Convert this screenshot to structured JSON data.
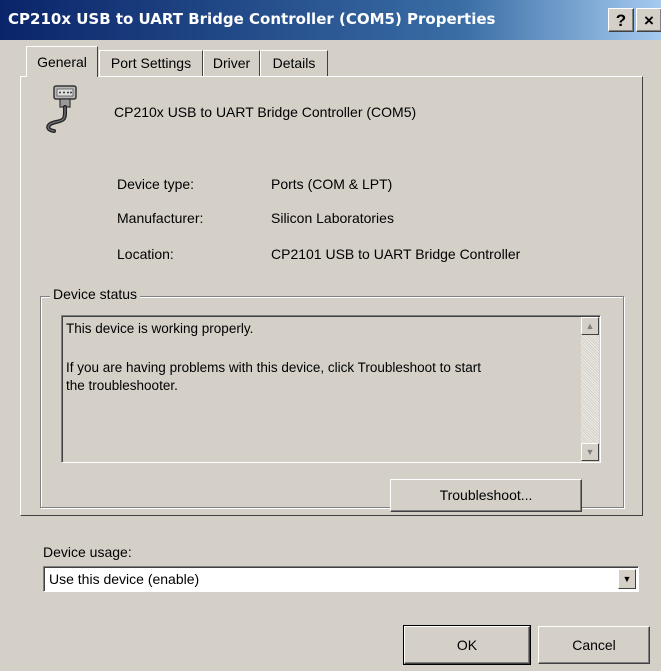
{
  "window": {
    "title": "CP210x USB to UART Bridge Controller (COM5) Properties",
    "help_label": "?",
    "close_label": "×"
  },
  "tabs": [
    {
      "label": "General",
      "active": true
    },
    {
      "label": "Port Settings",
      "active": false
    },
    {
      "label": "Driver",
      "active": false
    },
    {
      "label": "Details",
      "active": false
    }
  ],
  "device": {
    "icon": "serial-port-icon",
    "name": "CP210x USB to UART Bridge Controller (COM5)"
  },
  "properties": [
    {
      "label": "Device type:",
      "value": "Ports (COM & LPT)"
    },
    {
      "label": "Manufacturer:",
      "value": "Silicon Laboratories"
    },
    {
      "label": "Location:",
      "value": "CP2101 USB to UART Bridge Controller"
    }
  ],
  "device_status": {
    "legend": "Device status",
    "lines": [
      "This device is working properly.",
      "",
      "If you are having problems with this device, click Troubleshoot to start",
      "the troubleshooter."
    ],
    "troubleshoot_label": "Troubleshoot..."
  },
  "device_usage": {
    "label": "Device usage:",
    "selected": "Use this device (enable)"
  },
  "buttons": {
    "ok": "OK",
    "cancel": "Cancel"
  },
  "colors": {
    "title_gradient_start": "#0a246a",
    "title_gradient_end": "#a6caf0",
    "face": "#d4d0c8"
  }
}
